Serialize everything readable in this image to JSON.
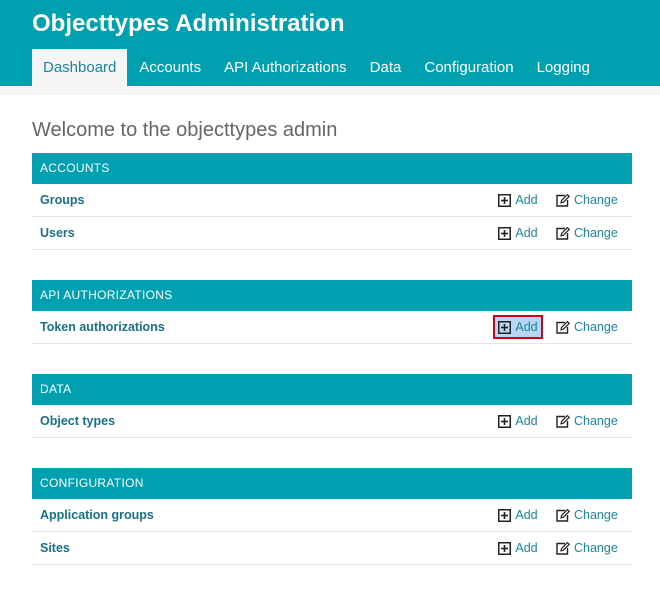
{
  "header": {
    "title": "Objecttypes Administration",
    "nav": [
      "Dashboard",
      "Accounts",
      "API Authorizations",
      "Data",
      "Configuration",
      "Logging"
    ],
    "active_tab": "Dashboard"
  },
  "welcome": "Welcome to the objecttypes admin",
  "actions": {
    "add": "Add",
    "change": "Change"
  },
  "modules": [
    {
      "caption": "Accounts",
      "rows": [
        "Groups",
        "Users"
      ]
    },
    {
      "caption": "API Authorizations",
      "rows": [
        "Token authorizations"
      ]
    },
    {
      "caption": "Data",
      "rows": [
        "Object types"
      ]
    },
    {
      "caption": "Configuration",
      "rows": [
        "Application groups",
        "Sites"
      ]
    }
  ],
  "colors": {
    "brand": "#00a0b0",
    "link": "#1a86a0",
    "highlight_border": "#d0021b"
  }
}
